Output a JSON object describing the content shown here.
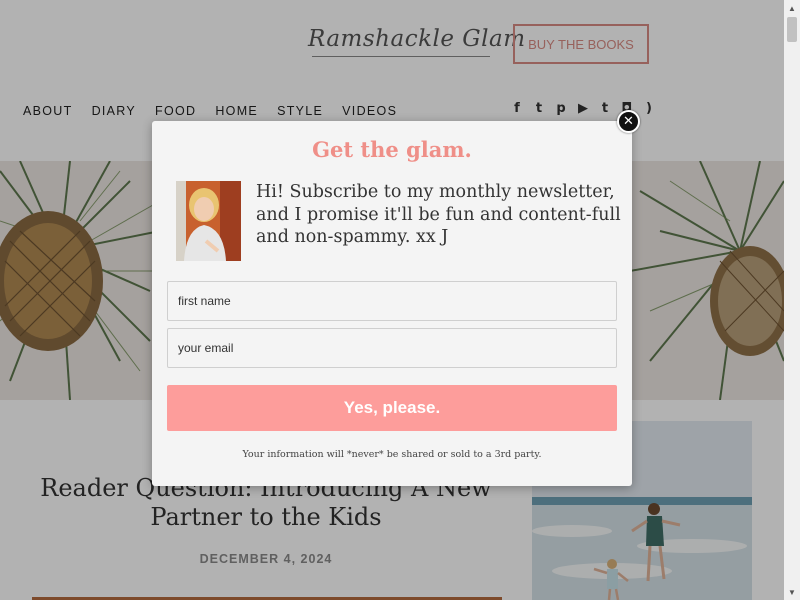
{
  "site": {
    "logo_text": "Ramshackle Glam",
    "buy_button_label": "BUY THE BOOKS"
  },
  "nav": {
    "items": [
      {
        "label": "ABOUT"
      },
      {
        "label": "DIARY"
      },
      {
        "label": "FOOD"
      },
      {
        "label": "HOME"
      },
      {
        "label": "STYLE"
      },
      {
        "label": "VIDEOS"
      }
    ]
  },
  "social": {
    "icons": [
      {
        "name": "facebook-icon",
        "glyph": "f"
      },
      {
        "name": "twitter-icon",
        "glyph": "t"
      },
      {
        "name": "pinterest-icon",
        "glyph": "p"
      },
      {
        "name": "youtube-icon",
        "glyph": "▶"
      },
      {
        "name": "tumblr-icon",
        "glyph": "t"
      },
      {
        "name": "instagram-icon",
        "glyph": "◘"
      },
      {
        "name": "rss-icon",
        "glyph": ")"
      }
    ]
  },
  "post": {
    "title": "Reader Question: Introducing A New Partner to the Kids",
    "date": "DECEMBER 4, 2024"
  },
  "modal": {
    "title": "Get the glam.",
    "intro": "Hi! Subscribe to my monthly newsletter, and I promise it'll be fun and content-full and non-spammy. xx J",
    "first_name_placeholder": "first name",
    "email_placeholder": "your email",
    "submit_label": "Yes, please.",
    "privacy_note": "Your information will *never* be shared or sold to a 3rd party.",
    "close_glyph": "✕"
  },
  "colors": {
    "accent": "#ef8f88",
    "button": "#fd9d9b",
    "buy_border": "#d98b84",
    "overlay": "rgba(0,0,0,0.30)"
  }
}
